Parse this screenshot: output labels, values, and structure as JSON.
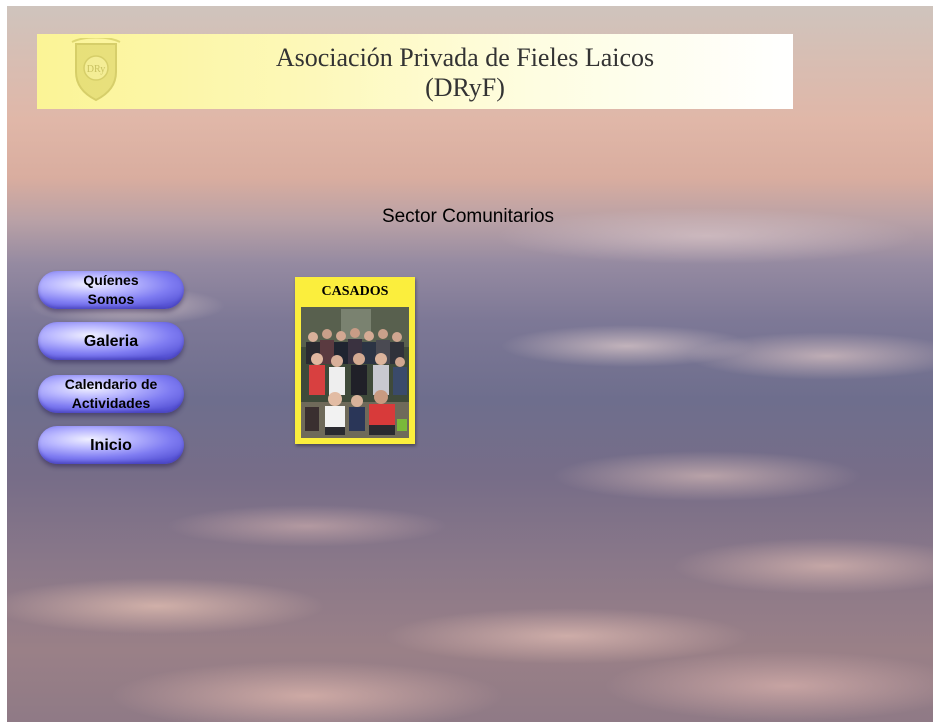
{
  "header": {
    "title_line1": "Asociación Privada de Fieles Laicos",
    "title_line2": "(DRyF)",
    "logo_icon": "crest-logo-icon",
    "banner_colors": [
      "#fbf496",
      "#ffffff"
    ]
  },
  "main": {
    "section_title": "Sector Comunitarios"
  },
  "nav": {
    "items": [
      {
        "label": "Quíenes\nSomos"
      },
      {
        "label": "Galeria"
      },
      {
        "label": "Calendario de\nActividades"
      },
      {
        "label": "Inicio"
      }
    ],
    "button_color": "#7f7cf2"
  },
  "cards": [
    {
      "label": "CASADOS",
      "image": "group-photo",
      "color": "#fbee3d"
    }
  ]
}
